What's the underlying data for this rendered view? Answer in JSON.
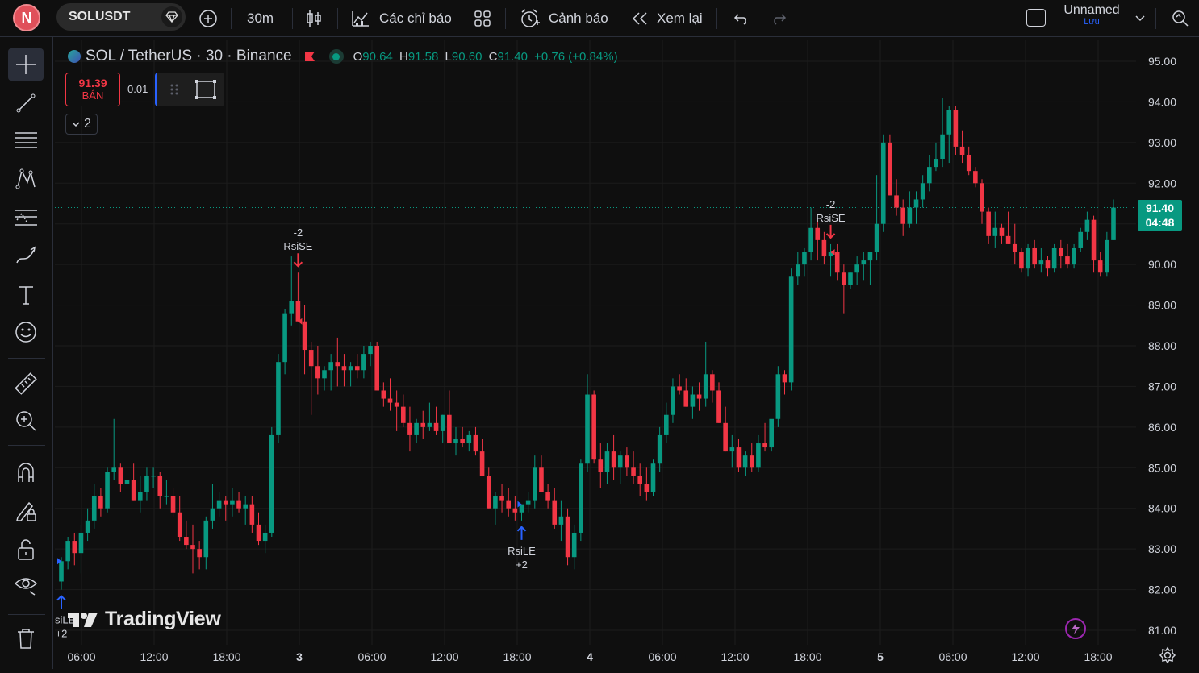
{
  "toolbar": {
    "avatar_letter": "N",
    "symbol": "SOLUSDT",
    "interval": "30m",
    "indicators_label": "Các chỉ báo",
    "alerts_label": "Cảnh báo",
    "replay_label": "Xem lại",
    "layout_name": "Unnamed",
    "save_label": "Lưu"
  },
  "legend": {
    "title": "SOL / TetherUS · 30 · Binance",
    "o_label": "O",
    "o_value": "90.64",
    "h_label": "H",
    "h_value": "91.58",
    "l_label": "L",
    "l_value": "90.60",
    "c_label": "C",
    "c_value": "91.40",
    "change": "+0.76 (+0.84%)"
  },
  "trade": {
    "sell_price": "91.39",
    "sell_label": "BÁN",
    "spread": "0.01",
    "collapse_count": "2"
  },
  "price_tag": {
    "price": "91.40",
    "countdown": "04:48"
  },
  "watermark": "TradingView",
  "colors": {
    "up": "#089981",
    "down": "#f23645",
    "buy_arrow": "#2962ff",
    "sell_arrow": "#f23645",
    "background": "#0f0f0f",
    "grid": "#1c1c1c"
  },
  "left_tools": [
    "crosshair-icon",
    "trend-line-icon",
    "fib-icon",
    "pattern-icon",
    "forecast-icon",
    "brush-icon",
    "text-icon",
    "emoji-icon",
    "ruler-icon",
    "zoom-in-icon",
    "magnet-icon",
    "lock-draw-icon",
    "lock-icon",
    "eye-icon",
    "trash-icon"
  ],
  "chart_data": {
    "type": "candlestick",
    "y_ticks": [
      "95.00",
      "94.00",
      "93.00",
      "92.00",
      "91.00",
      "90.00",
      "89.00",
      "88.00",
      "87.00",
      "86.00",
      "85.00",
      "84.00",
      "83.00",
      "82.00",
      "81.00"
    ],
    "ylim": [
      80.9,
      95.3
    ],
    "x_ticks": [
      "06:00",
      "12:00",
      "18:00",
      "3",
      "06:00",
      "12:00",
      "18:00",
      "4",
      "06:00",
      "12:00",
      "18:00",
      "5",
      "06:00",
      "12:00",
      "18:00"
    ],
    "bars": [
      [
        82.2,
        82.8,
        82.0,
        82.7
      ],
      [
        82.7,
        83.3,
        82.5,
        83.2
      ],
      [
        83.2,
        83.4,
        82.6,
        82.9
      ],
      [
        82.9,
        83.6,
        82.4,
        83.4
      ],
      [
        83.4,
        84.0,
        83.2,
        83.7
      ],
      [
        83.7,
        84.6,
        83.5,
        84.3
      ],
      [
        84.3,
        84.5,
        83.8,
        84.0
      ],
      [
        84.0,
        85.0,
        83.9,
        84.9
      ],
      [
        84.9,
        86.2,
        84.7,
        85.0
      ],
      [
        85.0,
        85.1,
        84.4,
        84.6
      ],
      [
        84.6,
        84.9,
        84.0,
        84.7
      ],
      [
        84.7,
        85.1,
        84.2,
        84.2
      ],
      [
        84.2,
        84.8,
        83.9,
        84.4
      ],
      [
        84.4,
        85.0,
        84.2,
        84.8
      ],
      [
        84.8,
        85.0,
        84.5,
        84.8
      ],
      [
        84.8,
        84.9,
        84.0,
        84.3
      ],
      [
        84.3,
        84.7,
        84.1,
        84.3
      ],
      [
        84.3,
        84.5,
        83.8,
        83.9
      ],
      [
        83.9,
        84.3,
        83.2,
        83.3
      ],
      [
        83.3,
        83.7,
        83.0,
        83.1
      ],
      [
        83.1,
        83.6,
        82.4,
        83.0
      ],
      [
        83.0,
        83.2,
        82.5,
        82.8
      ],
      [
        82.8,
        83.8,
        82.5,
        83.7
      ],
      [
        83.7,
        84.6,
        83.5,
        84.0
      ],
      [
        84.0,
        84.4,
        83.8,
        84.2
      ],
      [
        84.2,
        84.3,
        83.7,
        84.1
      ],
      [
        84.1,
        84.5,
        83.8,
        84.2
      ],
      [
        84.2,
        84.4,
        83.9,
        84.0
      ],
      [
        84.0,
        84.3,
        83.6,
        84.1
      ],
      [
        84.1,
        84.3,
        83.4,
        83.6
      ],
      [
        83.6,
        83.9,
        83.1,
        83.2
      ],
      [
        83.2,
        83.6,
        82.9,
        83.4
      ],
      [
        83.4,
        86.0,
        83.3,
        85.8
      ],
      [
        85.8,
        87.8,
        85.6,
        87.6
      ],
      [
        87.6,
        88.9,
        87.3,
        88.8
      ],
      [
        88.8,
        90.2,
        88.5,
        89.1
      ],
      [
        89.1,
        89.8,
        88.6,
        88.6
      ],
      [
        88.6,
        89.0,
        87.3,
        87.9
      ],
      [
        87.9,
        88.1,
        86.3,
        87.5
      ],
      [
        87.5,
        88.0,
        86.8,
        87.2
      ],
      [
        87.2,
        87.5,
        86.9,
        87.4
      ],
      [
        87.4,
        87.8,
        86.9,
        87.6
      ],
      [
        87.6,
        88.2,
        87.0,
        87.5
      ],
      [
        87.5,
        87.8,
        87.0,
        87.4
      ],
      [
        87.4,
        87.6,
        87.0,
        87.5
      ],
      [
        87.5,
        87.8,
        87.2,
        87.4
      ],
      [
        87.4,
        88.0,
        87.2,
        87.8
      ],
      [
        87.8,
        88.1,
        87.5,
        88.0
      ],
      [
        88.0,
        88.1,
        86.9,
        86.9
      ],
      [
        86.9,
        87.1,
        86.5,
        86.7
      ],
      [
        86.7,
        87.2,
        86.4,
        86.6
      ],
      [
        86.6,
        86.9,
        85.9,
        86.5
      ],
      [
        86.5,
        86.8,
        86.0,
        86.1
      ],
      [
        86.1,
        86.5,
        85.4,
        85.8
      ],
      [
        85.8,
        86.2,
        85.6,
        86.1
      ],
      [
        86.1,
        86.4,
        85.7,
        86.0
      ],
      [
        86.0,
        86.6,
        85.9,
        86.1
      ],
      [
        86.1,
        86.5,
        85.8,
        85.9
      ],
      [
        85.9,
        86.3,
        85.6,
        86.3
      ],
      [
        86.3,
        86.9,
        85.8,
        85.6
      ],
      [
        85.6,
        86.0,
        85.3,
        85.7
      ],
      [
        85.7,
        86.0,
        85.5,
        85.6
      ],
      [
        85.6,
        85.9,
        85.4,
        85.8
      ],
      [
        85.8,
        86.0,
        85.3,
        85.4
      ],
      [
        85.4,
        85.7,
        84.8,
        84.8
      ],
      [
        84.8,
        85.0,
        84.0,
        84.0
      ],
      [
        84.0,
        84.4,
        83.6,
        84.3
      ],
      [
        84.3,
        84.6,
        83.9,
        84.2
      ],
      [
        84.2,
        84.5,
        83.8,
        84.0
      ],
      [
        84.0,
        84.3,
        83.7,
        83.9
      ],
      [
        83.9,
        84.1,
        83.7,
        84.1
      ],
      [
        84.1,
        84.4,
        83.9,
        84.2
      ],
      [
        84.2,
        85.3,
        84.0,
        85.0
      ],
      [
        85.0,
        85.3,
        84.4,
        84.4
      ],
      [
        84.4,
        84.6,
        84.0,
        84.2
      ],
      [
        84.2,
        84.5,
        83.5,
        83.6
      ],
      [
        83.6,
        84.2,
        83.2,
        83.8
      ],
      [
        83.8,
        84.0,
        82.6,
        82.8
      ],
      [
        82.8,
        83.6,
        82.5,
        83.4
      ],
      [
        83.4,
        85.2,
        83.2,
        85.1
      ],
      [
        85.1,
        87.3,
        84.9,
        86.8
      ],
      [
        86.8,
        86.9,
        85.1,
        85.2
      ],
      [
        85.2,
        85.6,
        84.5,
        84.9
      ],
      [
        84.9,
        85.6,
        84.6,
        85.4
      ],
      [
        85.4,
        85.8,
        84.7,
        85.0
      ],
      [
        85.0,
        85.4,
        84.6,
        85.3
      ],
      [
        85.3,
        85.5,
        84.8,
        85.0
      ],
      [
        85.0,
        85.4,
        84.6,
        84.8
      ],
      [
        84.8,
        85.1,
        84.3,
        84.6
      ],
      [
        84.6,
        85.0,
        84.2,
        84.4
      ],
      [
        84.4,
        85.2,
        84.3,
        85.1
      ],
      [
        85.1,
        86.0,
        84.9,
        85.8
      ],
      [
        85.8,
        86.6,
        85.6,
        86.3
      ],
      [
        86.3,
        87.2,
        86.1,
        87.0
      ],
      [
        87.0,
        87.3,
        86.8,
        86.9
      ],
      [
        86.9,
        87.2,
        86.5,
        86.5
      ],
      [
        86.5,
        87.0,
        86.2,
        86.8
      ],
      [
        86.8,
        87.1,
        86.4,
        86.7
      ],
      [
        86.7,
        88.1,
        86.5,
        87.3
      ],
      [
        87.3,
        87.4,
        86.6,
        86.9
      ],
      [
        86.9,
        87.1,
        86.1,
        86.1
      ],
      [
        86.1,
        86.5,
        85.4,
        85.4
      ],
      [
        85.4,
        85.8,
        85.0,
        85.5
      ],
      [
        85.5,
        85.7,
        84.9,
        85.0
      ],
      [
        85.0,
        85.4,
        84.8,
        85.3
      ],
      [
        85.3,
        85.6,
        84.9,
        85.0
      ],
      [
        85.0,
        85.8,
        84.9,
        85.6
      ],
      [
        85.6,
        86.1,
        85.4,
        85.5
      ],
      [
        85.5,
        86.1,
        85.4,
        86.2
      ],
      [
        86.2,
        87.5,
        86.0,
        87.3
      ],
      [
        87.3,
        87.4,
        86.8,
        87.1
      ],
      [
        87.1,
        89.9,
        86.9,
        89.7
      ],
      [
        89.7,
        90.3,
        89.5,
        90.0
      ],
      [
        90.0,
        90.4,
        89.7,
        90.3
      ],
      [
        90.3,
        91.4,
        90.1,
        90.9
      ],
      [
        90.9,
        91.1,
        90.1,
        90.6
      ],
      [
        90.6,
        90.8,
        90.0,
        90.2
      ],
      [
        90.2,
        90.5,
        89.7,
        90.3
      ],
      [
        90.3,
        90.5,
        89.6,
        89.8
      ],
      [
        89.8,
        90.0,
        88.8,
        89.5
      ],
      [
        89.5,
        89.8,
        89.4,
        89.8
      ],
      [
        89.8,
        90.2,
        89.5,
        90.0
      ],
      [
        90.0,
        90.3,
        89.6,
        90.1
      ],
      [
        90.1,
        90.2,
        89.5,
        90.3
      ],
      [
        90.3,
        92.2,
        90.1,
        91.0
      ],
      [
        91.0,
        93.2,
        90.8,
        93.0
      ],
      [
        93.0,
        93.2,
        91.7,
        91.7
      ],
      [
        91.7,
        92.1,
        91.2,
        91.4
      ],
      [
        91.4,
        91.6,
        90.7,
        91.0
      ],
      [
        91.0,
        91.8,
        90.9,
        91.4
      ],
      [
        91.4,
        91.8,
        91.0,
        91.6
      ],
      [
        91.6,
        92.2,
        91.4,
        92.0
      ],
      [
        92.0,
        92.7,
        91.8,
        92.4
      ],
      [
        92.4,
        93.0,
        92.3,
        92.6
      ],
      [
        92.6,
        94.1,
        92.4,
        93.2
      ],
      [
        93.2,
        93.9,
        92.5,
        93.8
      ],
      [
        93.8,
        93.9,
        92.7,
        92.9
      ],
      [
        92.9,
        93.3,
        92.5,
        92.7
      ],
      [
        92.7,
        92.9,
        92.2,
        92.3
      ],
      [
        92.3,
        92.4,
        91.9,
        92.0
      ],
      [
        92.0,
        92.1,
        91.0,
        91.3
      ],
      [
        91.3,
        91.4,
        90.5,
        90.7
      ],
      [
        90.7,
        91.3,
        90.4,
        90.9
      ],
      [
        90.9,
        91.0,
        90.5,
        90.7
      ],
      [
        90.7,
        91.3,
        90.5,
        90.5
      ],
      [
        90.5,
        91.0,
        90.0,
        90.3
      ],
      [
        90.3,
        90.4,
        89.8,
        89.9
      ],
      [
        89.9,
        90.5,
        89.7,
        90.4
      ],
      [
        90.4,
        90.6,
        89.9,
        90.0
      ],
      [
        90.0,
        90.4,
        89.8,
        90.1
      ],
      [
        90.1,
        90.2,
        89.7,
        89.9
      ],
      [
        89.9,
        90.5,
        89.8,
        90.4
      ],
      [
        90.4,
        90.6,
        89.9,
        90.2
      ],
      [
        90.2,
        90.5,
        89.9,
        90.0
      ],
      [
        90.0,
        90.5,
        89.9,
        90.4
      ],
      [
        90.4,
        90.9,
        90.3,
        90.8
      ],
      [
        90.8,
        91.3,
        90.6,
        91.1
      ],
      [
        91.1,
        91.2,
        89.8,
        90.1
      ],
      [
        90.1,
        90.3,
        89.7,
        89.8
      ],
      [
        89.8,
        90.8,
        89.7,
        90.6
      ],
      [
        90.6,
        91.6,
        90.6,
        91.4
      ]
    ],
    "markers": [
      {
        "type": "buy",
        "label": "RsiLE",
        "qty": "+2",
        "bar": 0
      },
      {
        "type": "sell",
        "label": "RsiSE",
        "qty": "-2",
        "bar": 36
      },
      {
        "type": "buy",
        "label": "RsiLE",
        "qty": "+2",
        "bar": 70
      },
      {
        "type": "sell",
        "label": "RsiSE",
        "qty": "-2",
        "bar": 117
      }
    ],
    "last_price": 91.4
  }
}
